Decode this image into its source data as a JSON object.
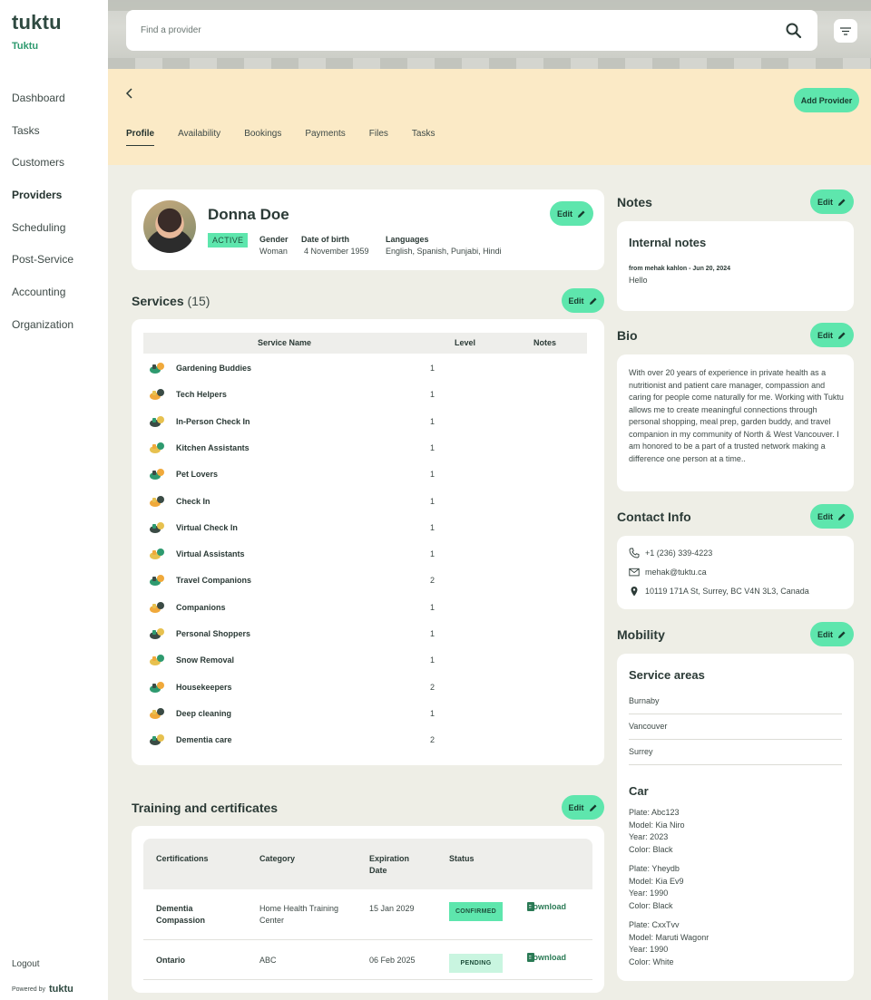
{
  "sidebar": {
    "logo": "tuktu",
    "org": "Tuktu",
    "items": [
      "Dashboard",
      "Tasks",
      "Customers",
      "Providers",
      "Scheduling",
      "Post-Service",
      "Accounting",
      "Organization"
    ],
    "active": "Providers",
    "logout": "Logout",
    "powered_by": "Powered by",
    "powered_brand": "tuktu"
  },
  "search": {
    "placeholder": "Find a provider"
  },
  "toolbar": {
    "add_provider": "Add Provider"
  },
  "tabs": [
    "Profile",
    "Availability",
    "Bookings",
    "Payments",
    "Files",
    "Tasks"
  ],
  "profile": {
    "name": "Donna Doe",
    "status": "ACTIVE",
    "gender_label": "Gender",
    "gender": "Woman",
    "dob_label": "Date of birth",
    "dob": "4 November 1959",
    "languages_label": "Languages",
    "languages": "English, Spanish, Punjabi, Hindi",
    "edit": "Edit"
  },
  "services": {
    "title": "Services",
    "count": "(15)",
    "edit": "Edit",
    "headers": {
      "name": "Service Name",
      "level": "Level",
      "notes": "Notes"
    },
    "rows": [
      {
        "name": "Gardening Buddies",
        "level": "1",
        "icon": "gardening-icon"
      },
      {
        "name": "Tech Helpers",
        "level": "1",
        "icon": "laptop-icon"
      },
      {
        "name": "In-Person Check In",
        "level": "1",
        "icon": "handshake-icon"
      },
      {
        "name": "Kitchen Assistants",
        "level": "1",
        "icon": "cooking-icon"
      },
      {
        "name": "Pet Lovers",
        "level": "1",
        "icon": "pet-icon"
      },
      {
        "name": "Check In",
        "level": "1",
        "icon": "handshake-icon"
      },
      {
        "name": "Virtual Check In",
        "level": "1",
        "icon": "chat-icon"
      },
      {
        "name": "Virtual Assistants",
        "level": "1",
        "icon": "assistant-icon"
      },
      {
        "name": "Travel Companions",
        "level": "2",
        "icon": "car-icon"
      },
      {
        "name": "Companions",
        "level": "1",
        "icon": "companions-icon"
      },
      {
        "name": "Personal Shoppers",
        "level": "1",
        "icon": "shopping-icon"
      },
      {
        "name": "Snow Removal",
        "level": "1",
        "icon": "shovel-icon"
      },
      {
        "name": "Housekeepers",
        "level": "2",
        "icon": "cleaning-icon"
      },
      {
        "name": "Deep cleaning",
        "level": "1",
        "icon": "deep-cleaning-icon"
      },
      {
        "name": "Dementia care",
        "level": "2",
        "icon": "care-icon"
      }
    ]
  },
  "training": {
    "title": "Training and certificates",
    "edit": "Edit",
    "headers": {
      "cert": "Certifications",
      "category": "Category",
      "expiration": "Expiration Date",
      "status": "Status"
    },
    "rows": [
      {
        "cert": "Dementia Compassion",
        "category": "Home Health Training Center",
        "date": "15 Jan 2029",
        "status": "CONFIRMED",
        "action": "Download"
      },
      {
        "cert": "Ontario",
        "category": "ABC",
        "date": "06 Feb 2025",
        "status": "PENDING",
        "action": "Download"
      }
    ]
  },
  "notes": {
    "title": "Notes",
    "edit": "Edit",
    "card_title": "Internal notes",
    "meta": "from mehak kahlon - Jun 20, 2024",
    "text": "Hello"
  },
  "bio": {
    "title": "Bio",
    "edit": "Edit",
    "text": "With over 20 years of experience in private health as a nutritionist and patient care manager, compassion and caring for people come naturally for me. Working with Tuktu allows me to create meaningful connections through personal shopping, meal prep, garden buddy, and travel companion in my community of North & West Vancouver. I am honored to be a part of a trusted network making a difference one person at a time.."
  },
  "contact": {
    "title": "Contact Info",
    "edit": "Edit",
    "phone": "+1 (236) 339-4223",
    "email": "mehak@tuktu.ca",
    "address": "10119 171A St, Surrey, BC V4N 3L3, Canada"
  },
  "mobility": {
    "title": "Mobility",
    "edit": "Edit",
    "areas_title": "Service areas",
    "areas": [
      "Burnaby",
      "Vancouver",
      "Surrey"
    ],
    "car_title": "Car",
    "cars": [
      {
        "plate": "Plate: Abc123",
        "model": "Model: Kia Niro",
        "year": "Year: 2023",
        "color": "Color: Black"
      },
      {
        "plate": "Plate: Yheydb",
        "model": "Model: Kia Ev9",
        "year": "Year: 1990",
        "color": "Color: Black"
      },
      {
        "plate": "Plate: CxxTvv",
        "model": "Model: Maruti Wagonr",
        "year": "Year: 1990",
        "color": "Color: White"
      }
    ]
  },
  "colors": {
    "accent": "#5ee6ad",
    "banner": "#fbeac6",
    "background": "#eeeee6",
    "link": "#2a7a55"
  }
}
